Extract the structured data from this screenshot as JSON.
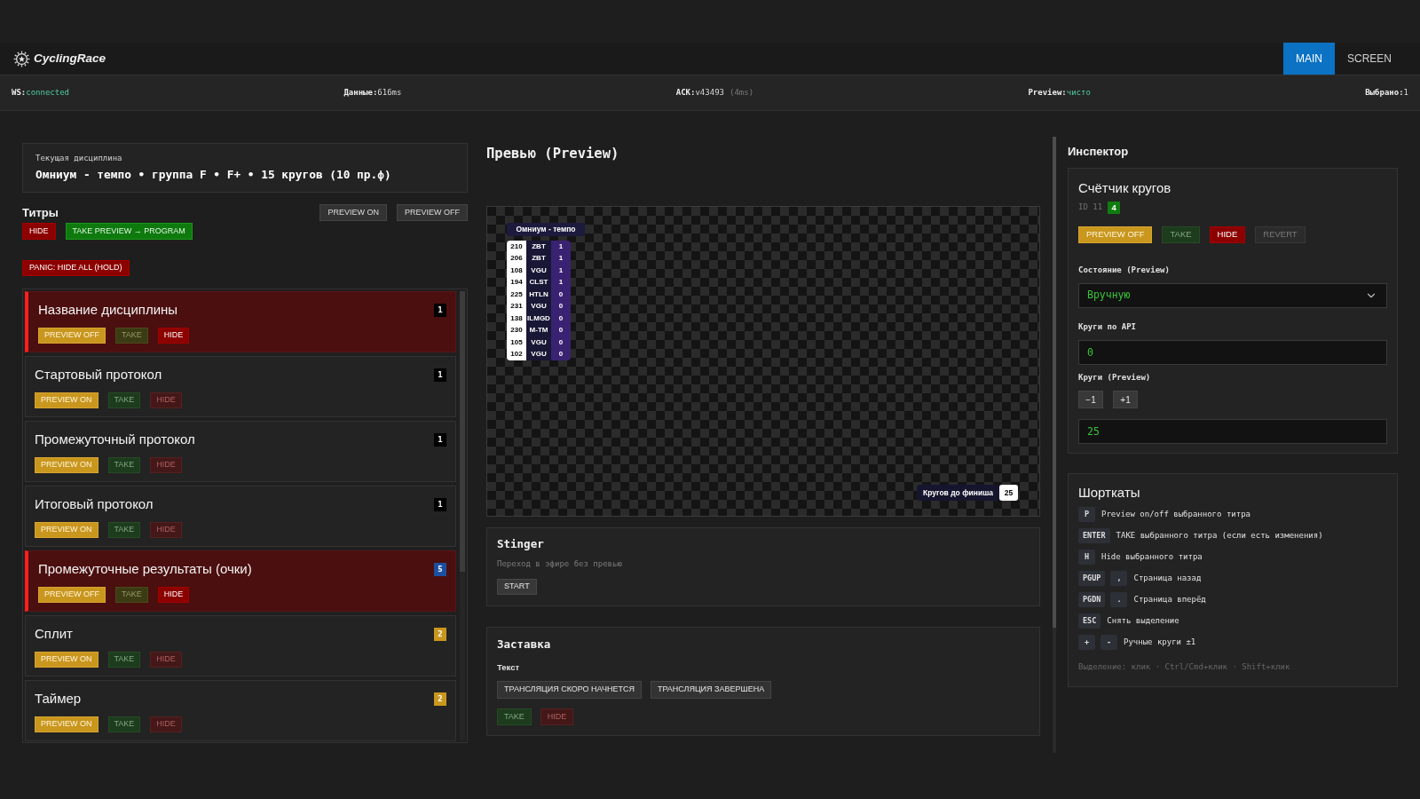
{
  "header": {
    "logo": "CyclingRace",
    "tabs": [
      {
        "label": "MAIN",
        "selected": true
      },
      {
        "label": "SCREEN",
        "selected": false
      }
    ]
  },
  "status_bar": [
    {
      "label": "WS:",
      "value": "connected",
      "ok": true
    },
    {
      "label": "Данные:",
      "value": "616ms",
      "ok": false
    },
    {
      "label": "ACK:",
      "value": "v43493",
      "ok": false,
      "note": "(4ms)"
    },
    {
      "label": "Preview:",
      "value": "чисто",
      "ok": true
    },
    {
      "label": "Выбрано:",
      "value": "1",
      "ok": false
    }
  ],
  "discipline": {
    "label": "Текущая дисциплина",
    "value": "Омниум - темпо • группа F • F+ • 15 кругов (10 пр.ф)"
  },
  "titles": {
    "heading": "Титры",
    "preview_buttons": [
      "PREVIEW ON",
      "PREVIEW OFF"
    ],
    "hide_button": "HIDE",
    "take_button": "TAKE PREVIEW → PROGRAM",
    "panic_button": "PANIC: HIDE ALL (HOLD)",
    "items": [
      {
        "title": "Название дисциплины",
        "count": "1",
        "color": "#000000",
        "live": true,
        "buttons": [
          {
            "kind": "preview",
            "label": "PREVIEW OFF"
          },
          {
            "kind": "take",
            "label": "TAKE"
          },
          {
            "kind": "hide",
            "label": "HIDE"
          }
        ]
      },
      {
        "title": "Стартовый протокол",
        "count": "1",
        "color": "#000000",
        "live": false,
        "buttons": [
          {
            "kind": "preview",
            "label": "PREVIEW ON"
          },
          {
            "kind": "take",
            "label": "TAKE"
          },
          {
            "kind": "hide",
            "label": "HIDE"
          }
        ]
      },
      {
        "title": "Промежуточный протокол",
        "count": "1",
        "color": "#000000",
        "live": false,
        "buttons": [
          {
            "kind": "preview",
            "label": "PREVIEW ON"
          },
          {
            "kind": "take",
            "label": "TAKE"
          },
          {
            "kind": "hide",
            "label": "HIDE"
          }
        ]
      },
      {
        "title": "Итоговый протокол",
        "count": "1",
        "color": "#000000",
        "live": false,
        "buttons": [
          {
            "kind": "preview",
            "label": "PREVIEW ON"
          },
          {
            "kind": "take",
            "label": "TAKE"
          },
          {
            "kind": "hide",
            "label": "HIDE"
          }
        ]
      },
      {
        "title": "Промежуточные результаты (очки)",
        "count": "5",
        "color": "#1c4fa0",
        "live": true,
        "buttons": [
          {
            "kind": "preview",
            "label": "PREVIEW OFF"
          },
          {
            "kind": "take",
            "label": "TAKE"
          },
          {
            "kind": "hide",
            "label": "HIDE"
          }
        ]
      },
      {
        "title": "Сплит",
        "count": "2",
        "color": "#c9961e",
        "live": false,
        "buttons": [
          {
            "kind": "preview",
            "label": "PREVIEW ON"
          },
          {
            "kind": "take",
            "label": "TAKE"
          },
          {
            "kind": "hide",
            "label": "HIDE"
          }
        ]
      },
      {
        "title": "Таймер",
        "count": "2",
        "color": "#c9961e",
        "live": false,
        "buttons": [
          {
            "kind": "preview",
            "label": "PREVIEW ON"
          },
          {
            "kind": "take",
            "label": "TAKE"
          },
          {
            "kind": "hide",
            "label": "HIDE"
          }
        ]
      }
    ]
  },
  "preview": {
    "heading": "Превью (Preview)",
    "overlay_title": "Омниум - темпо",
    "standings": [
      {
        "number": "210",
        "team": "ZBT",
        "points": "1"
      },
      {
        "number": "206",
        "team": "ZBT",
        "points": "1"
      },
      {
        "number": "108",
        "team": "VGU",
        "points": "1"
      },
      {
        "number": "194",
        "team": "CLST",
        "points": "1"
      },
      {
        "number": "225",
        "team": "HTLN",
        "points": "0"
      },
      {
        "number": "231",
        "team": "VGU",
        "points": "0"
      },
      {
        "number": "138",
        "team": "ILMGD",
        "points": "0"
      },
      {
        "number": "230",
        "team": "M-TM",
        "points": "0"
      },
      {
        "number": "105",
        "team": "VGU",
        "points": "0"
      },
      {
        "number": "102",
        "team": "VGU",
        "points": "0"
      }
    ],
    "laps_label": "Кругов до финиша",
    "laps_value": "25"
  },
  "stinger": {
    "title": "Stinger",
    "hint": "Переход в эфире без превью",
    "button": "START"
  },
  "splash": {
    "title": "Заставка",
    "label": "Текст",
    "options": [
      "ТРАНСЛЯЦИЯ СКОРО НАЧНЕТСЯ",
      "ТРАНСЛЯЦИЯ ЗАВЕРШЕНА"
    ],
    "buttons": [
      {
        "kind": "take",
        "label": "TAKE"
      },
      {
        "kind": "hide",
        "label": "HIDE"
      }
    ]
  },
  "inspector": {
    "heading": "Инспектор",
    "title": "Счётчик кругов",
    "id": "ID 11",
    "badge": "4",
    "live": true,
    "buttons": [
      {
        "kind": "preview",
        "label": "PREVIEW OFF",
        "disabled": false
      },
      {
        "kind": "take",
        "label": "TAKE",
        "disabled": false
      },
      {
        "kind": "hide",
        "label": "HIDE",
        "disabled": false
      },
      {
        "kind": "revert",
        "label": "REVERT",
        "disabled": true
      }
    ],
    "state": {
      "label": "Состояние (Preview)",
      "value": "Вручную"
    },
    "api_laps": {
      "label": "Круги по API",
      "value": "0"
    },
    "preview_laps": {
      "label": "Круги (Preview)",
      "buttons": [
        "−1",
        "+1"
      ],
      "value": "25"
    }
  },
  "shortcuts": {
    "heading": "Шорткаты",
    "items": [
      {
        "keys": [
          "P"
        ],
        "text": "Preview on/off выбранного титра"
      },
      {
        "keys": [
          "ENTER"
        ],
        "text": "TAKE выбранного титра (если есть изменения)"
      },
      {
        "keys": [
          "H"
        ],
        "text": "Hide выбранного титра"
      },
      {
        "keys": [
          "PGUP",
          ","
        ],
        "text": "Страница назад"
      },
      {
        "keys": [
          "PGDN",
          "."
        ],
        "text": "Страница вперёд"
      },
      {
        "keys": [
          "ESC"
        ],
        "text": "Снять выделение"
      },
      {
        "keys": [
          "+",
          "-"
        ],
        "text": "Ручные круги ±1"
      }
    ],
    "footer": "Выделение: клик · Ctrl/Cmd+клик · Shift+клик"
  }
}
